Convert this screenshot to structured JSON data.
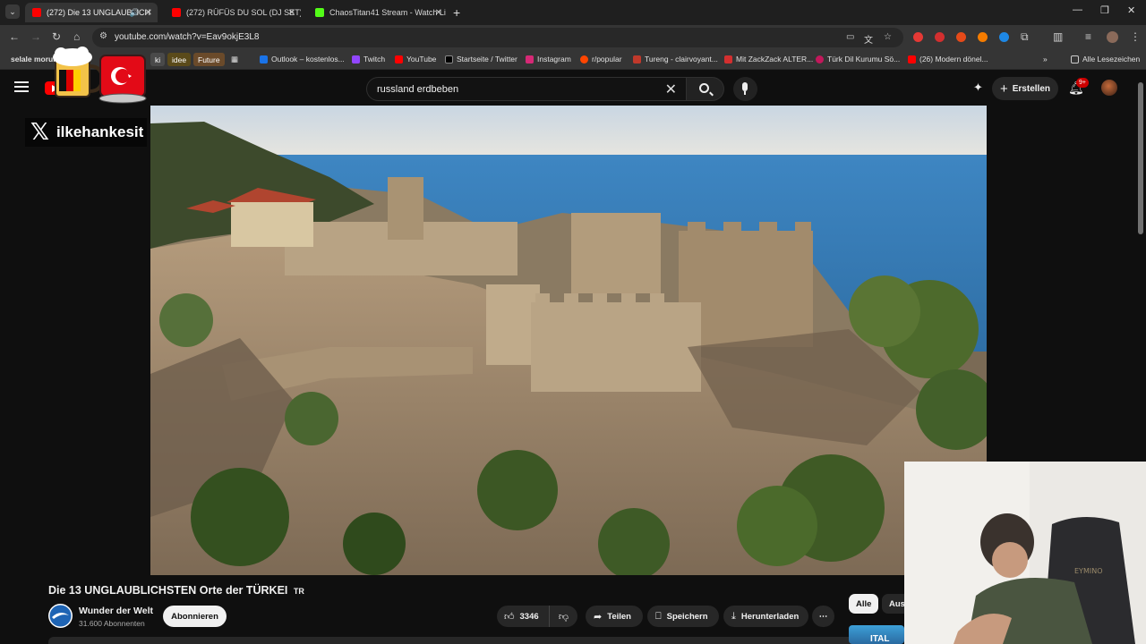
{
  "browser": {
    "tabs": [
      {
        "label": "(272) Die 13 UNGLAUBLICH",
        "active": true
      },
      {
        "label": "(272) RÜFÜS DU SOL (DJ SET) -",
        "active": false
      },
      {
        "label": "ChaosTitan41 Stream - Watch Li",
        "active": false
      }
    ],
    "url": "youtube.com/watch?v=Eav9okjE3L8",
    "bookmarks": [
      {
        "label": "selale moruk",
        "type": "text"
      },
      {
        "label": "ki",
        "type": "chip",
        "color": "#4a4a4a"
      },
      {
        "label": "idee",
        "type": "chip",
        "color": "#5a4a1a"
      },
      {
        "label": "Future",
        "type": "chip",
        "color": "#6a4a2a"
      },
      {
        "label": "Outlook – kostenlos...",
        "color": "#1a73e8"
      },
      {
        "label": "Twitch",
        "color": "#9146ff"
      },
      {
        "label": "YouTube",
        "color": "#ff0000"
      },
      {
        "label": "Startseite / Twitter",
        "color": "#000000"
      },
      {
        "label": "Instagram",
        "color": "#d62976"
      },
      {
        "label": "r/popular",
        "color": "#ff4500"
      },
      {
        "label": "Tureng - clairvoyant...",
        "color": "#c0392b"
      },
      {
        "label": "Mit ZackZack ALTER...",
        "color": "#d32f2f"
      },
      {
        "label": "Türk Dil Kurumu Sö...",
        "color": "#c2185b"
      },
      {
        "label": "(26) Modern dönel...",
        "color": "#ff0000"
      }
    ],
    "all_bookmarks_label": "Alle Lesezeichen"
  },
  "header": {
    "search_query": "russland erdbeben",
    "create_label": "Erstellen",
    "notification_count": "9+"
  },
  "overlay": {
    "x_handle": "ilkehankesit"
  },
  "video": {
    "title": "Die 13 UNGLAUBLICHSTEN Orte der TÜRKEI",
    "title_suffix": "TR",
    "channel_name": "Wunder der Welt",
    "subscribers": "31.600 Abonnenten",
    "subscribe_label": "Abonnieren",
    "likes": "3346",
    "share_label": "Teilen",
    "save_label": "Speichern",
    "download_label": "Herunterladen"
  },
  "sidebar": {
    "chips": [
      "Alle",
      "Aus"
    ],
    "thumb_text": "ITAL"
  },
  "colors": {
    "youtube_red": "#ff0000",
    "background": "#0f0f0f",
    "pill_bg": "#272727",
    "sea": "#3f7fb5"
  }
}
